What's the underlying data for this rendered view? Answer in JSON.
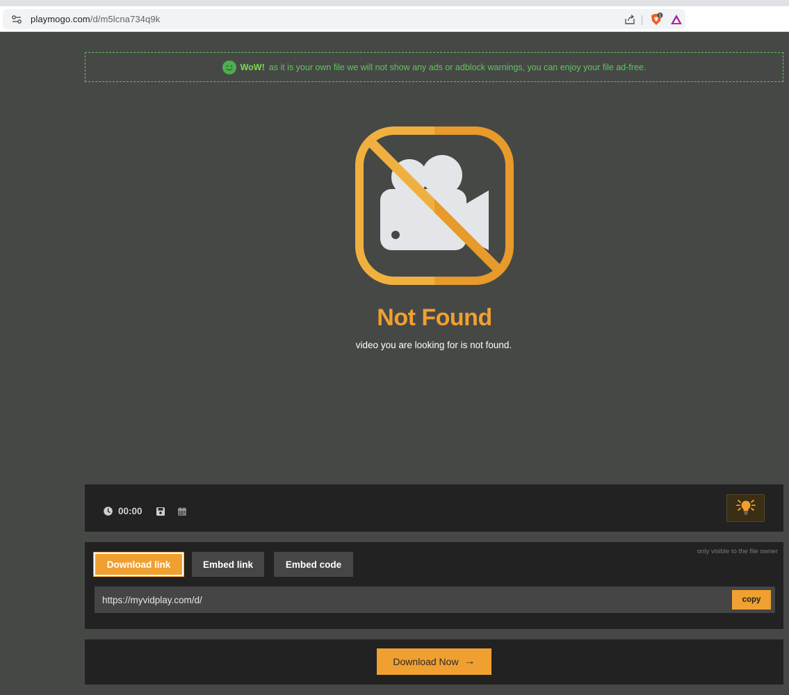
{
  "browser": {
    "url_host": "playmogo.com",
    "url_path": "/d/m5lcna734q9k",
    "brave_badge": "1"
  },
  "banner": {
    "strong": "WoW!",
    "text": "as it is your own file we will not show any ads or adblock warnings, you can enjoy your file ad-free."
  },
  "not_found": {
    "title": "Not Found",
    "description": "video you are looking for is not found."
  },
  "player": {
    "time": "00:00"
  },
  "links": {
    "owner_note": "only visible to the file owner",
    "tabs": [
      "Download link",
      "Embed link",
      "Embed code"
    ],
    "active_tab": "Download link",
    "url_value": "https://myvidplay.com/d/",
    "copy_label": "copy"
  },
  "download": {
    "label": "Download Now",
    "arrow": "→"
  },
  "colors": {
    "accent": "#f0a030",
    "background": "#464846",
    "panel": "#222222",
    "success": "#62c462"
  }
}
